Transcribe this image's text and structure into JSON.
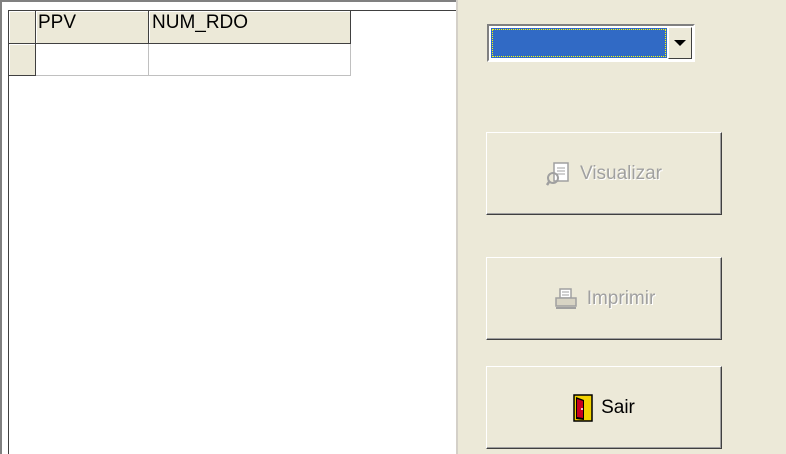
{
  "grid": {
    "columns": [
      "PPV",
      "NUM_RDO"
    ],
    "rows": [
      [
        "",
        ""
      ]
    ]
  },
  "combo": {
    "value": ""
  },
  "buttons": {
    "visualizar": {
      "label": "Visualizar",
      "icon": "preview-icon",
      "enabled": false
    },
    "imprimir": {
      "label": "Imprimir",
      "icon": "printer-icon",
      "enabled": false
    },
    "sair": {
      "label": "Sair",
      "icon": "exit-door-icon",
      "enabled": true
    }
  },
  "colors": {
    "background": "#ECE9D8",
    "selection": "#316AC5",
    "disabled_text": "#A0A0A0"
  }
}
